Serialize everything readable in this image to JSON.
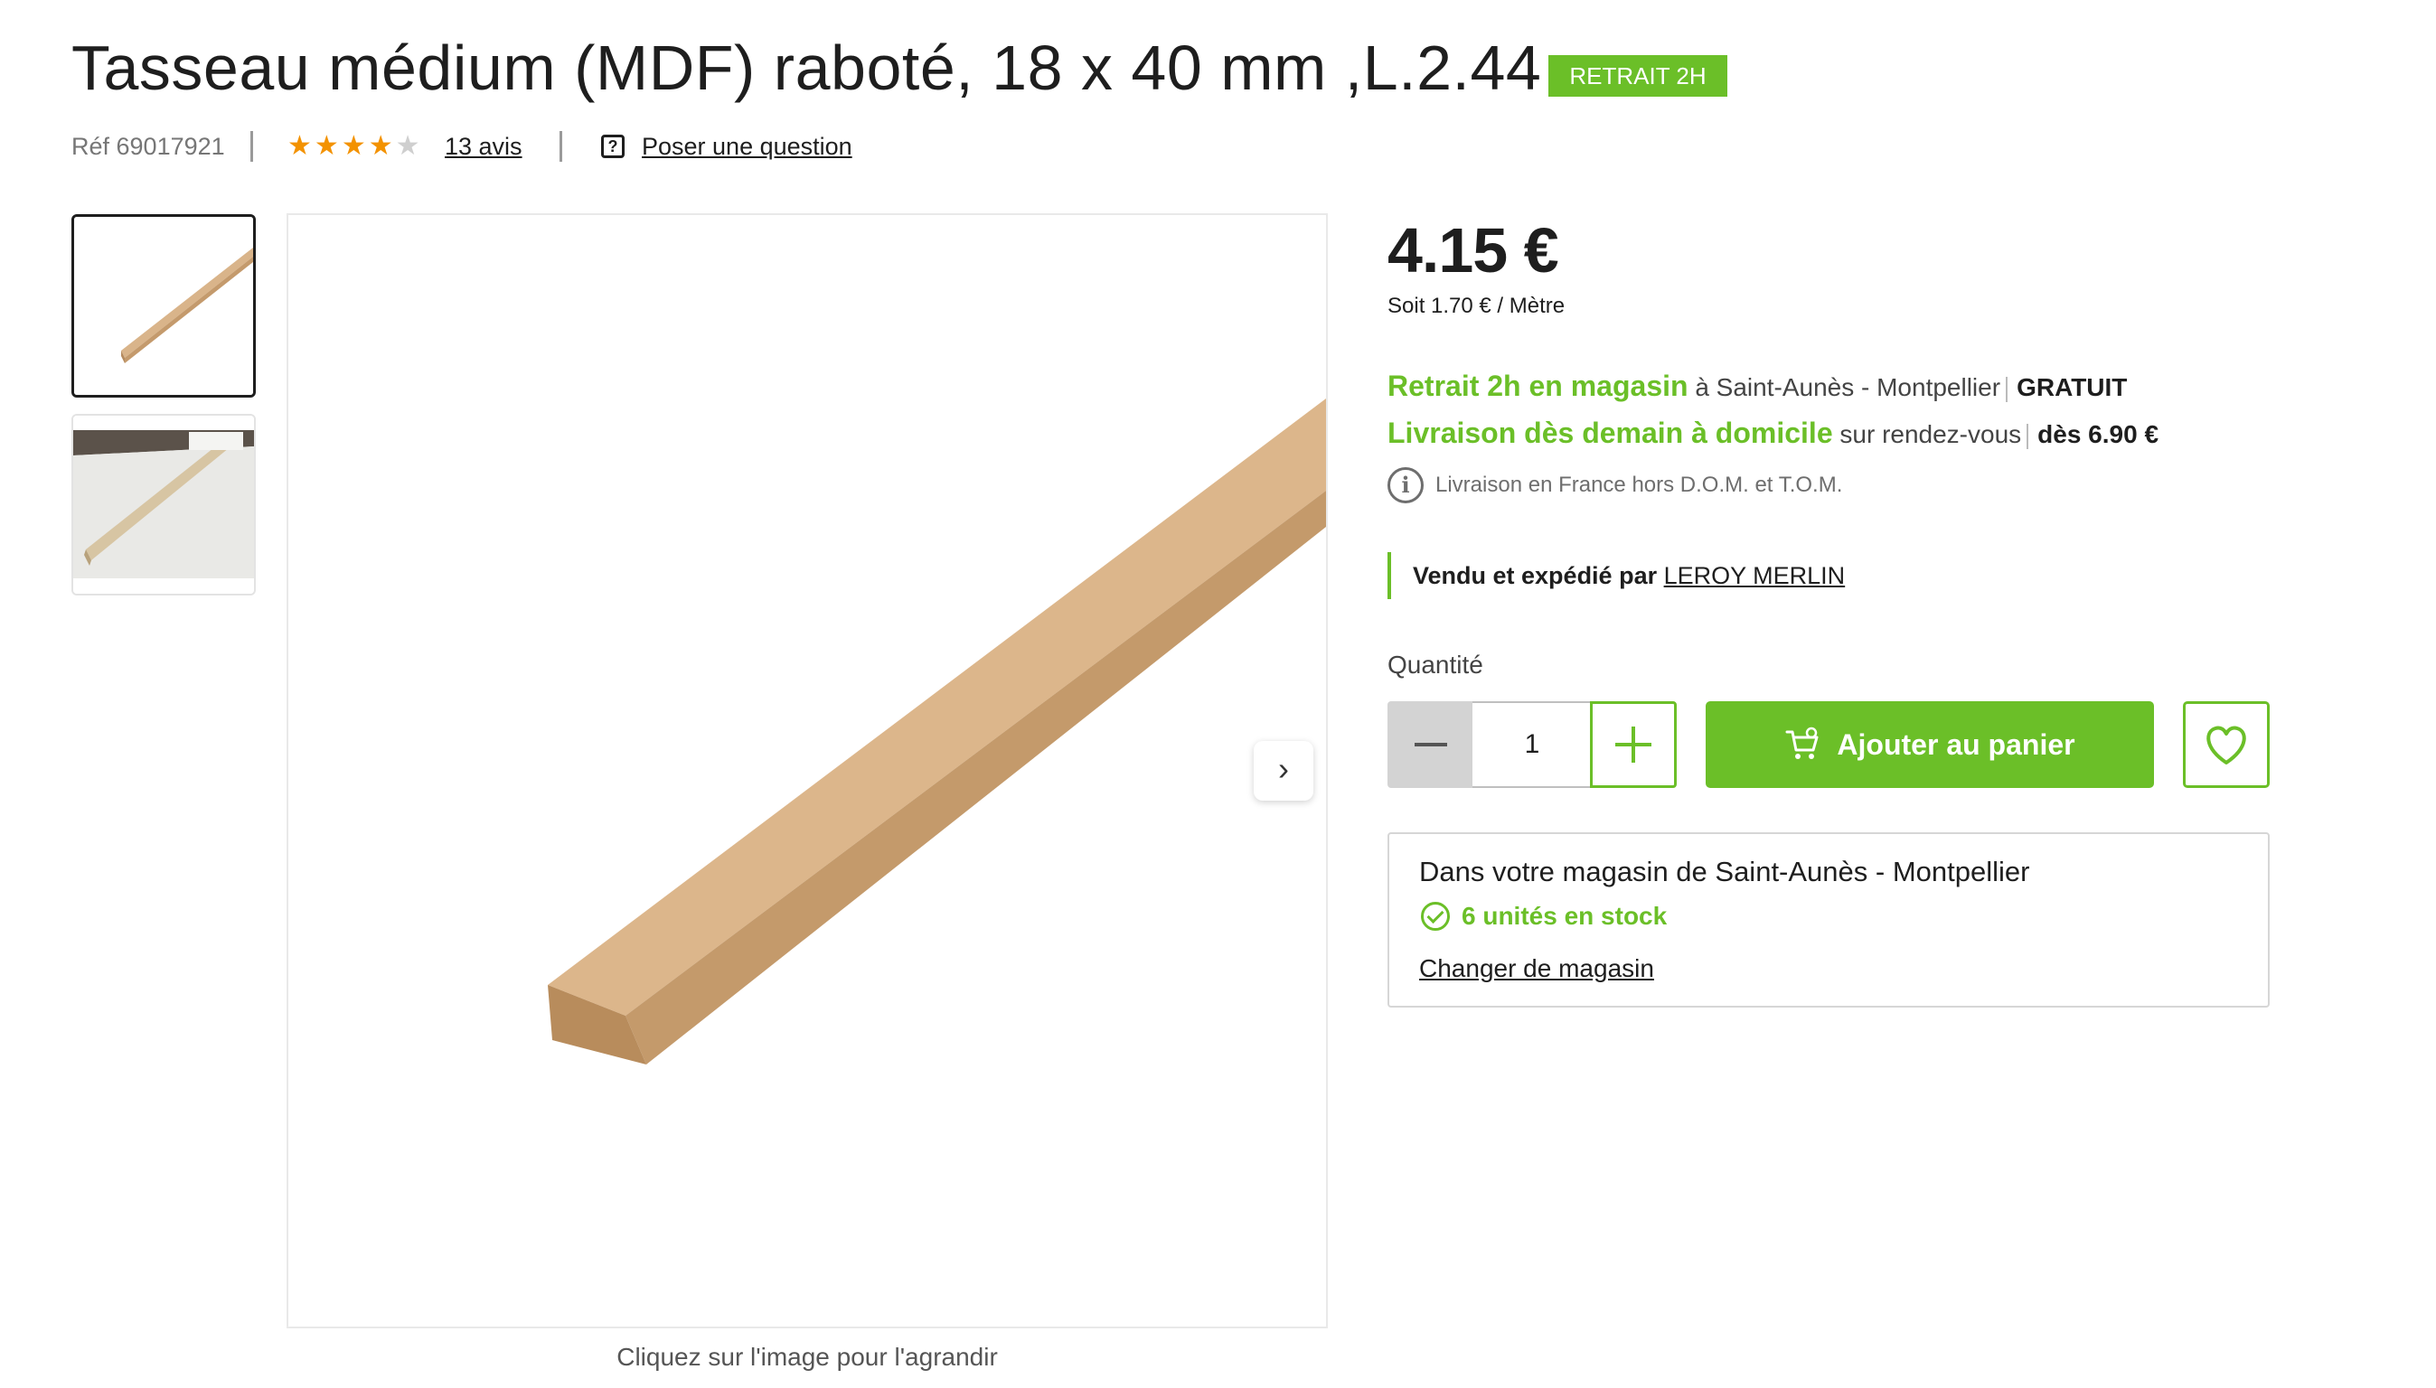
{
  "product": {
    "title": "Tasseau médium (MDF) raboté, 18 x 40 mm ,L.2.44 m",
    "badge": "RETRAIT 2H",
    "ref": "Réf 69017921",
    "rating": 4,
    "rating_max": 5,
    "reviews_label": "13 avis",
    "question_label": "Poser une question"
  },
  "gallery": {
    "caption": "Cliquez sur l'image pour l'agrandir",
    "thumbnails": [
      "thumbnail-1",
      "thumbnail-2"
    ],
    "next_icon": "chevron-right-icon"
  },
  "pricing": {
    "price": "4.15 €",
    "unit_price": "Soit 1.70 € / Mètre"
  },
  "delivery": {
    "pickup_highlight": "Retrait 2h en magasin",
    "pickup_place": "à Saint-Aunès - Montpellier",
    "pickup_cost": "GRATUIT",
    "home_highlight": "Livraison dès demain à domicile",
    "home_detail": "sur rendez-vous",
    "home_cost": "dès 6.90 €",
    "info_note": "Livraison en France hors D.O.M. et T.O.M."
  },
  "vendor": {
    "prefix": "Vendu et expédié par",
    "name": "LEROY MERLIN"
  },
  "purchase": {
    "quantity_label": "Quantité",
    "quantity_value": "1",
    "add_to_cart_label": "Ajouter au panier"
  },
  "store": {
    "title": "Dans votre magasin de Saint-Aunès - Montpellier",
    "stock": "6 unités en stock",
    "change_label": "Changer de magasin"
  },
  "colors": {
    "accent": "#6bbf28",
    "star": "#f39200",
    "text": "#1e1e1e"
  }
}
